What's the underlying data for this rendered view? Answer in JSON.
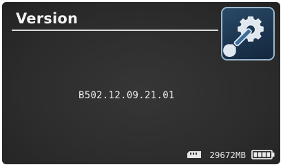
{
  "header": {
    "title": "Version"
  },
  "settings_tile": {
    "icon": "gear-wrench-icon",
    "accent": "#9eb8cc"
  },
  "main": {
    "version_value": "B502.12.09.21.01"
  },
  "status_bar": {
    "storage_icon": "sd-card-icon",
    "storage_text": "29672MB",
    "battery_icon": "battery-icon",
    "battery_level": 1.0
  }
}
